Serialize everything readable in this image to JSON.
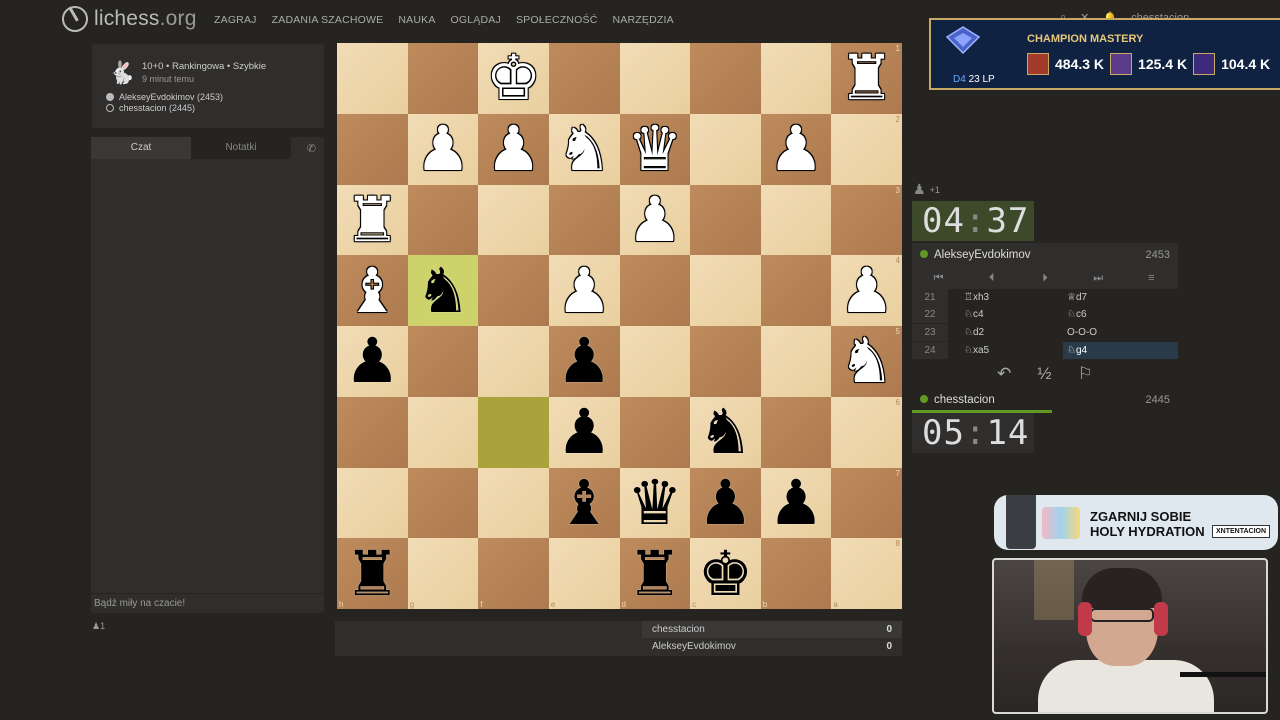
{
  "header": {
    "logo_text": "lichess",
    "logo_org": ".org",
    "nav": [
      "ZAGRAJ",
      "ZADANIA SZACHOWE",
      "NAUKA",
      "OGLĄDAJ",
      "SPOŁECZNOŚĆ",
      "NARZĘDZIA"
    ],
    "username": "chesstacion"
  },
  "mastery": {
    "title": "CHAMPION MASTERY",
    "rank_div": "D4",
    "rank_lp": "23 LP",
    "items": [
      {
        "value": "484.3 K",
        "color": "#a33b2a"
      },
      {
        "value": "125.4 K",
        "color": "#5b3c8a"
      },
      {
        "value": "104.4 K",
        "color": "#3b2a7a"
      }
    ]
  },
  "game_info": {
    "line1": "10+0 • Rankingowa • Szybkie",
    "line2": "9 minut temu",
    "white_player": "AlekseyEvdokimov (2453)",
    "black_player": "chesstacion (2445)"
  },
  "chat": {
    "tab_chat": "Czat",
    "tab_notes": "Notatki",
    "placeholder": "Bądź miły na czacie!",
    "spectators": "1"
  },
  "board": {
    "rows": [
      [
        null,
        null,
        "wK",
        null,
        null,
        null,
        null,
        "wR"
      ],
      [
        null,
        "wP",
        "wP",
        "wN",
        "wQ",
        null,
        "wP",
        null
      ],
      [
        "wR",
        null,
        null,
        null,
        "wP",
        null,
        null,
        null
      ],
      [
        "wB",
        "bN",
        null,
        "wP",
        null,
        null,
        null,
        "wP"
      ],
      [
        "bP",
        null,
        null,
        "bP",
        null,
        null,
        null,
        "wN"
      ],
      [
        null,
        null,
        null,
        "bP",
        null,
        "bN",
        null,
        null
      ],
      [
        null,
        null,
        null,
        "bB",
        "bQ",
        "bP",
        "bP",
        null
      ],
      [
        "bR",
        null,
        null,
        null,
        "bR",
        "bK",
        null,
        null
      ]
    ],
    "highlights": [
      [
        3,
        1
      ],
      [
        5,
        2
      ]
    ],
    "rank_labels": [
      "1",
      "2",
      "3",
      "4",
      "5",
      "6",
      "7",
      "8"
    ],
    "file_labels": [
      "h",
      "g",
      "f",
      "e",
      "d",
      "c",
      "b",
      "a"
    ]
  },
  "scores": [
    {
      "name": "chesstacion",
      "score": "0"
    },
    {
      "name": "AlekseyEvdokimov",
      "score": "0"
    }
  ],
  "right": {
    "material": "+1",
    "top_clock_min": "04",
    "top_clock_sec": "37",
    "bottom_clock_min": "05",
    "bottom_clock_sec": "14",
    "top_player": "AlekseyEvdokimov",
    "top_rating": "2453",
    "bottom_player": "chesstacion",
    "bottom_rating": "2445",
    "moves": [
      {
        "num": "21",
        "white": "♖xh3",
        "black": "♕d7"
      },
      {
        "num": "22",
        "white": "♘c4",
        "black": "♘c6"
      },
      {
        "num": "23",
        "white": "♘d2",
        "black": "O-O-O"
      },
      {
        "num": "24",
        "white": "♘xa5",
        "black": "♘g4"
      }
    ],
    "draw_symbol": "½"
  },
  "ad": {
    "title_line1": "ZGARNIJ SOBIE",
    "title_line2": "HOLY HYDRATION",
    "tag": "XNTENTACION"
  }
}
